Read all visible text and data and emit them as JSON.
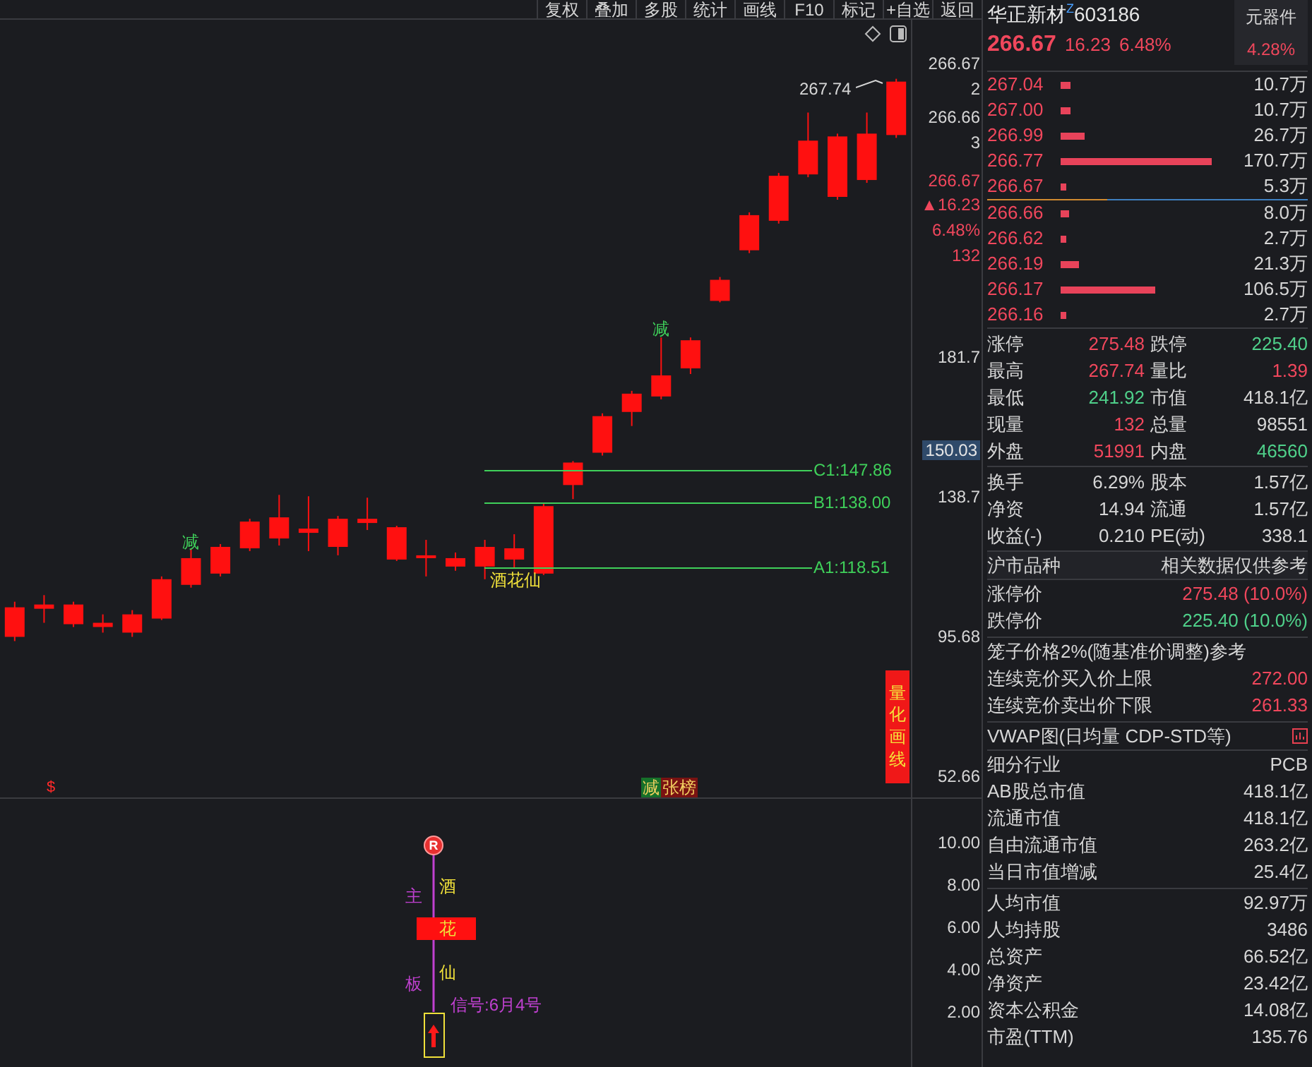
{
  "toolbar": [
    "复权",
    "叠加",
    "多股",
    "统计",
    "画线",
    "F10",
    "标记",
    "+自选",
    "返回"
  ],
  "main_chart": {
    "chart_data": {
      "type": "candlestick",
      "categories": [
        null,
        null,
        null,
        null,
        null,
        null,
        null,
        null,
        null,
        null,
        null,
        null,
        null,
        null,
        null,
        null,
        null,
        null,
        null,
        null,
        null,
        null,
        null,
        null,
        null,
        null,
        null,
        null,
        null,
        null,
        null
      ],
      "ylim": [
        -35.48,
        285.22
      ],
      "yticks": [
        181.7,
        138.7,
        95.68,
        52.66
      ],
      "series": [
        {
          "color": "#ff1010",
          "ohlc": [
            [
              95.48,
              106.28,
              94.18,
              104.56
            ],
            [
              104.12,
              108.31,
              99.8,
              105.42
            ],
            [
              99.37,
              106.28,
              98.51,
              105.42
            ],
            [
              98.51,
              102.39,
              96.78,
              99.8
            ],
            [
              96.78,
              103.69,
              95.48,
              102.39
            ],
            [
              101.1,
              114.06,
              100.67,
              113.2
            ],
            [
              111.47,
              122.71,
              110.61,
              119.68
            ],
            [
              114.93,
              124.01,
              114.06,
              123.14
            ],
            [
              122.71,
              131.78,
              121.84,
              130.92
            ],
            [
              125.73,
              139.13,
              123.57,
              132.22
            ],
            [
              127.46,
              138.7,
              121.84,
              128.76
            ],
            [
              123.14,
              132.65,
              120.55,
              131.78
            ],
            [
              130.49,
              138.27,
              128.33,
              131.78
            ],
            [
              119.25,
              129.62,
              118.82,
              129.19
            ],
            [
              119.68,
              125.3,
              114.06,
              120.55
            ],
            [
              117.09,
              121.41,
              115.79,
              119.68
            ],
            [
              117.09,
              125.3,
              113.2,
              123.14
            ],
            [
              119.25,
              127.03,
              116.66,
              122.71
            ],
            [
              114.93,
              136.54,
              114.5,
              135.67
            ],
            [
              142.16,
              149.51,
              137.84,
              149.07
            ],
            [
              152.1,
              164.2,
              151.23,
              163.34
            ],
            [
              164.63,
              171.12,
              160.31,
              170.25
            ],
            [
              169.39,
              187.54,
              168.52,
              175.87
            ],
            [
              178.03,
              187.54,
              176.3,
              186.67
            ],
            [
              198.78,
              206.12,
              198.34,
              205.26
            ],
            [
              214.34,
              226.0,
              213.47,
              225.14
            ],
            [
              223.41,
              238.11,
              222.55,
              237.24
            ],
            [
              237.67,
              256.69,
              236.81,
              248.05
            ],
            [
              230.76,
              250.21,
              229.89,
              249.34
            ],
            [
              235.95,
              256.69,
              235.08,
              250.21
            ],
            [
              249.78,
              267.07,
              248.91,
              266.2
            ]
          ]
        }
      ]
    },
    "high_label": "267.74",
    "levels": [
      {
        "label": "C1:147.86"
      },
      {
        "label": "B1:138.00"
      },
      {
        "label": "A1:118.51"
      }
    ],
    "annotations": [
      {
        "kind": "reduce",
        "text": "减"
      },
      {
        "kind": "reduce",
        "text": "减"
      },
      {
        "kind": "signal",
        "text": "酒花仙"
      }
    ],
    "marker": "$",
    "badges": [
      {
        "text": "减",
        "color": "#16702a"
      },
      {
        "text": "张榜",
        "color": "#7a1212"
      }
    ],
    "side_button": "量化画线"
  },
  "price_axis": [
    {
      "text": "266.67",
      "kind": "plain"
    },
    {
      "text": "2",
      "kind": "plain"
    },
    {
      "text": "266.66",
      "kind": "plain"
    },
    {
      "text": "3",
      "kind": "plain"
    },
    {
      "text": "266.67",
      "kind": "quote"
    },
    {
      "text": "▲16.23",
      "kind": "quote"
    },
    {
      "text": "6.48%",
      "kind": "quote"
    },
    {
      "text": "132",
      "kind": "quote"
    },
    {
      "text": "150.03",
      "kind": "current"
    }
  ],
  "sub_chart": {
    "marker": "R",
    "left_chars": [
      "主",
      "板"
    ],
    "chars": [
      "酒",
      "花",
      "仙"
    ],
    "signal": "信号:6月4号",
    "axis": [
      "10.00",
      "8.00",
      "6.00",
      "4.00",
      "2.00"
    ]
  },
  "stock": {
    "name": "华正新材",
    "flag": "Z",
    "code": "603186",
    "price": "266.67",
    "change": "16.23",
    "change_pct": "6.48%",
    "sector": "元器件",
    "sector_change": "4.28%"
  },
  "order_book": {
    "asks": [
      {
        "price": "267.04",
        "volume": "10.7万"
      },
      {
        "price": "267.00",
        "volume": "10.7万"
      },
      {
        "price": "266.99",
        "volume": "26.7万"
      },
      {
        "price": "266.77",
        "volume": "170.7万"
      },
      {
        "price": "266.67",
        "volume": "5.3万"
      }
    ],
    "bids": [
      {
        "price": "266.66",
        "volume": "8.0万"
      },
      {
        "price": "266.62",
        "volume": "2.7万"
      },
      {
        "price": "266.19",
        "volume": "21.3万"
      },
      {
        "price": "266.17",
        "volume": "106.5万"
      },
      {
        "price": "266.16",
        "volume": "2.7万"
      }
    ]
  },
  "stats": [
    [
      {
        "label": "涨停",
        "value": "275.48",
        "color": "#f0475c"
      },
      {
        "label": "跌停",
        "value": "225.40",
        "color": "#4fd08a"
      }
    ],
    [
      {
        "label": "最高",
        "value": "267.74",
        "color": "#f0475c"
      },
      {
        "label": "量比",
        "value": "1.39",
        "color": "#f0475c"
      }
    ],
    [
      {
        "label": "最低",
        "value": "241.92",
        "color": "#4fd08a"
      },
      {
        "label": "市值",
        "value": "418.1亿",
        "color": "#d6d6d6"
      }
    ],
    [
      {
        "label": "现量",
        "value": "132",
        "color": "#f0475c"
      },
      {
        "label": "总量",
        "value": "98551",
        "color": "#d6d6d6"
      }
    ],
    [
      {
        "label": "外盘",
        "value": "51991",
        "color": "#f0475c"
      },
      {
        "label": "内盘",
        "value": "46560",
        "color": "#4fd08a"
      }
    ]
  ],
  "stats2": [
    [
      {
        "label": "换手",
        "value": "6.29%"
      },
      {
        "label": "股本",
        "value": "1.57亿"
      }
    ],
    [
      {
        "label": "净资",
        "value": "14.94"
      },
      {
        "label": "流通",
        "value": "1.57亿"
      }
    ],
    [
      {
        "label": "收益(-)",
        "value": "0.210"
      },
      {
        "label": "PE(动)",
        "value": "338.1"
      }
    ]
  ],
  "market": {
    "label": "沪市品种",
    "note": "相关数据仅供参考"
  },
  "limits": [
    {
      "label": "涨停价",
      "value": "275.48 (10.0%)",
      "color": "#f0475c"
    },
    {
      "label": "跌停价",
      "value": "225.40 (10.0%)",
      "color": "#4fd08a"
    }
  ],
  "cage": {
    "title": "笼子价格2%(随基准价调整)参考",
    "rows": [
      {
        "label": "连续竞价买入价上限",
        "value": "272.00"
      },
      {
        "label": "连续竞价卖出价下限",
        "value": "261.33"
      }
    ]
  },
  "vwap": "VWAP图(日均量 CDP-STD等)",
  "industry": [
    {
      "label": "细分行业",
      "value": "PCB"
    },
    {
      "label": "AB股总市值",
      "value": "418.1亿"
    },
    {
      "label": "流通市值",
      "value": "418.1亿"
    },
    {
      "label": "自由流通市值",
      "value": "263.2亿"
    },
    {
      "label": "当日市值增减",
      "value": "25.4亿"
    }
  ],
  "per_capita": [
    {
      "label": "人均市值",
      "value": "92.97万"
    },
    {
      "label": "人均持股",
      "value": "3486"
    },
    {
      "label": "总资产",
      "value": "66.52亿"
    },
    {
      "label": "净资产",
      "value": "23.42亿"
    },
    {
      "label": "资本公积金",
      "value": "14.08亿"
    },
    {
      "label": "市盈(TTM)",
      "value": "135.76"
    }
  ]
}
